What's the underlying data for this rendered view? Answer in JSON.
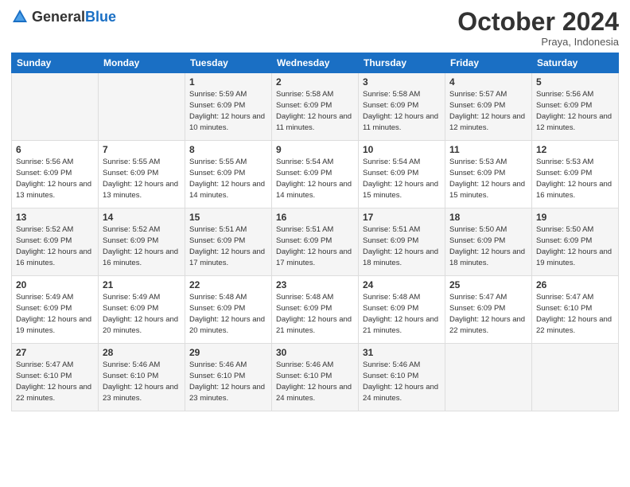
{
  "logo": {
    "general": "General",
    "blue": "Blue"
  },
  "header": {
    "month": "October 2024",
    "location": "Praya, Indonesia"
  },
  "weekdays": [
    "Sunday",
    "Monday",
    "Tuesday",
    "Wednesday",
    "Thursday",
    "Friday",
    "Saturday"
  ],
  "weeks": [
    [
      {
        "day": "",
        "sunrise": "",
        "sunset": "",
        "daylight": ""
      },
      {
        "day": "",
        "sunrise": "",
        "sunset": "",
        "daylight": ""
      },
      {
        "day": "1",
        "sunrise": "Sunrise: 5:59 AM",
        "sunset": "Sunset: 6:09 PM",
        "daylight": "Daylight: 12 hours and 10 minutes."
      },
      {
        "day": "2",
        "sunrise": "Sunrise: 5:58 AM",
        "sunset": "Sunset: 6:09 PM",
        "daylight": "Daylight: 12 hours and 11 minutes."
      },
      {
        "day": "3",
        "sunrise": "Sunrise: 5:58 AM",
        "sunset": "Sunset: 6:09 PM",
        "daylight": "Daylight: 12 hours and 11 minutes."
      },
      {
        "day": "4",
        "sunrise": "Sunrise: 5:57 AM",
        "sunset": "Sunset: 6:09 PM",
        "daylight": "Daylight: 12 hours and 12 minutes."
      },
      {
        "day": "5",
        "sunrise": "Sunrise: 5:56 AM",
        "sunset": "Sunset: 6:09 PM",
        "daylight": "Daylight: 12 hours and 12 minutes."
      }
    ],
    [
      {
        "day": "6",
        "sunrise": "Sunrise: 5:56 AM",
        "sunset": "Sunset: 6:09 PM",
        "daylight": "Daylight: 12 hours and 13 minutes."
      },
      {
        "day": "7",
        "sunrise": "Sunrise: 5:55 AM",
        "sunset": "Sunset: 6:09 PM",
        "daylight": "Daylight: 12 hours and 13 minutes."
      },
      {
        "day": "8",
        "sunrise": "Sunrise: 5:55 AM",
        "sunset": "Sunset: 6:09 PM",
        "daylight": "Daylight: 12 hours and 14 minutes."
      },
      {
        "day": "9",
        "sunrise": "Sunrise: 5:54 AM",
        "sunset": "Sunset: 6:09 PM",
        "daylight": "Daylight: 12 hours and 14 minutes."
      },
      {
        "day": "10",
        "sunrise": "Sunrise: 5:54 AM",
        "sunset": "Sunset: 6:09 PM",
        "daylight": "Daylight: 12 hours and 15 minutes."
      },
      {
        "day": "11",
        "sunrise": "Sunrise: 5:53 AM",
        "sunset": "Sunset: 6:09 PM",
        "daylight": "Daylight: 12 hours and 15 minutes."
      },
      {
        "day": "12",
        "sunrise": "Sunrise: 5:53 AM",
        "sunset": "Sunset: 6:09 PM",
        "daylight": "Daylight: 12 hours and 16 minutes."
      }
    ],
    [
      {
        "day": "13",
        "sunrise": "Sunrise: 5:52 AM",
        "sunset": "Sunset: 6:09 PM",
        "daylight": "Daylight: 12 hours and 16 minutes."
      },
      {
        "day": "14",
        "sunrise": "Sunrise: 5:52 AM",
        "sunset": "Sunset: 6:09 PM",
        "daylight": "Daylight: 12 hours and 16 minutes."
      },
      {
        "day": "15",
        "sunrise": "Sunrise: 5:51 AM",
        "sunset": "Sunset: 6:09 PM",
        "daylight": "Daylight: 12 hours and 17 minutes."
      },
      {
        "day": "16",
        "sunrise": "Sunrise: 5:51 AM",
        "sunset": "Sunset: 6:09 PM",
        "daylight": "Daylight: 12 hours and 17 minutes."
      },
      {
        "day": "17",
        "sunrise": "Sunrise: 5:51 AM",
        "sunset": "Sunset: 6:09 PM",
        "daylight": "Daylight: 12 hours and 18 minutes."
      },
      {
        "day": "18",
        "sunrise": "Sunrise: 5:50 AM",
        "sunset": "Sunset: 6:09 PM",
        "daylight": "Daylight: 12 hours and 18 minutes."
      },
      {
        "day": "19",
        "sunrise": "Sunrise: 5:50 AM",
        "sunset": "Sunset: 6:09 PM",
        "daylight": "Daylight: 12 hours and 19 minutes."
      }
    ],
    [
      {
        "day": "20",
        "sunrise": "Sunrise: 5:49 AM",
        "sunset": "Sunset: 6:09 PM",
        "daylight": "Daylight: 12 hours and 19 minutes."
      },
      {
        "day": "21",
        "sunrise": "Sunrise: 5:49 AM",
        "sunset": "Sunset: 6:09 PM",
        "daylight": "Daylight: 12 hours and 20 minutes."
      },
      {
        "day": "22",
        "sunrise": "Sunrise: 5:48 AM",
        "sunset": "Sunset: 6:09 PM",
        "daylight": "Daylight: 12 hours and 20 minutes."
      },
      {
        "day": "23",
        "sunrise": "Sunrise: 5:48 AM",
        "sunset": "Sunset: 6:09 PM",
        "daylight": "Daylight: 12 hours and 21 minutes."
      },
      {
        "day": "24",
        "sunrise": "Sunrise: 5:48 AM",
        "sunset": "Sunset: 6:09 PM",
        "daylight": "Daylight: 12 hours and 21 minutes."
      },
      {
        "day": "25",
        "sunrise": "Sunrise: 5:47 AM",
        "sunset": "Sunset: 6:09 PM",
        "daylight": "Daylight: 12 hours and 22 minutes."
      },
      {
        "day": "26",
        "sunrise": "Sunrise: 5:47 AM",
        "sunset": "Sunset: 6:10 PM",
        "daylight": "Daylight: 12 hours and 22 minutes."
      }
    ],
    [
      {
        "day": "27",
        "sunrise": "Sunrise: 5:47 AM",
        "sunset": "Sunset: 6:10 PM",
        "daylight": "Daylight: 12 hours and 22 minutes."
      },
      {
        "day": "28",
        "sunrise": "Sunrise: 5:46 AM",
        "sunset": "Sunset: 6:10 PM",
        "daylight": "Daylight: 12 hours and 23 minutes."
      },
      {
        "day": "29",
        "sunrise": "Sunrise: 5:46 AM",
        "sunset": "Sunset: 6:10 PM",
        "daylight": "Daylight: 12 hours and 23 minutes."
      },
      {
        "day": "30",
        "sunrise": "Sunrise: 5:46 AM",
        "sunset": "Sunset: 6:10 PM",
        "daylight": "Daylight: 12 hours and 24 minutes."
      },
      {
        "day": "31",
        "sunrise": "Sunrise: 5:46 AM",
        "sunset": "Sunset: 6:10 PM",
        "daylight": "Daylight: 12 hours and 24 minutes."
      },
      {
        "day": "",
        "sunrise": "",
        "sunset": "",
        "daylight": ""
      },
      {
        "day": "",
        "sunrise": "",
        "sunset": "",
        "daylight": ""
      }
    ]
  ]
}
